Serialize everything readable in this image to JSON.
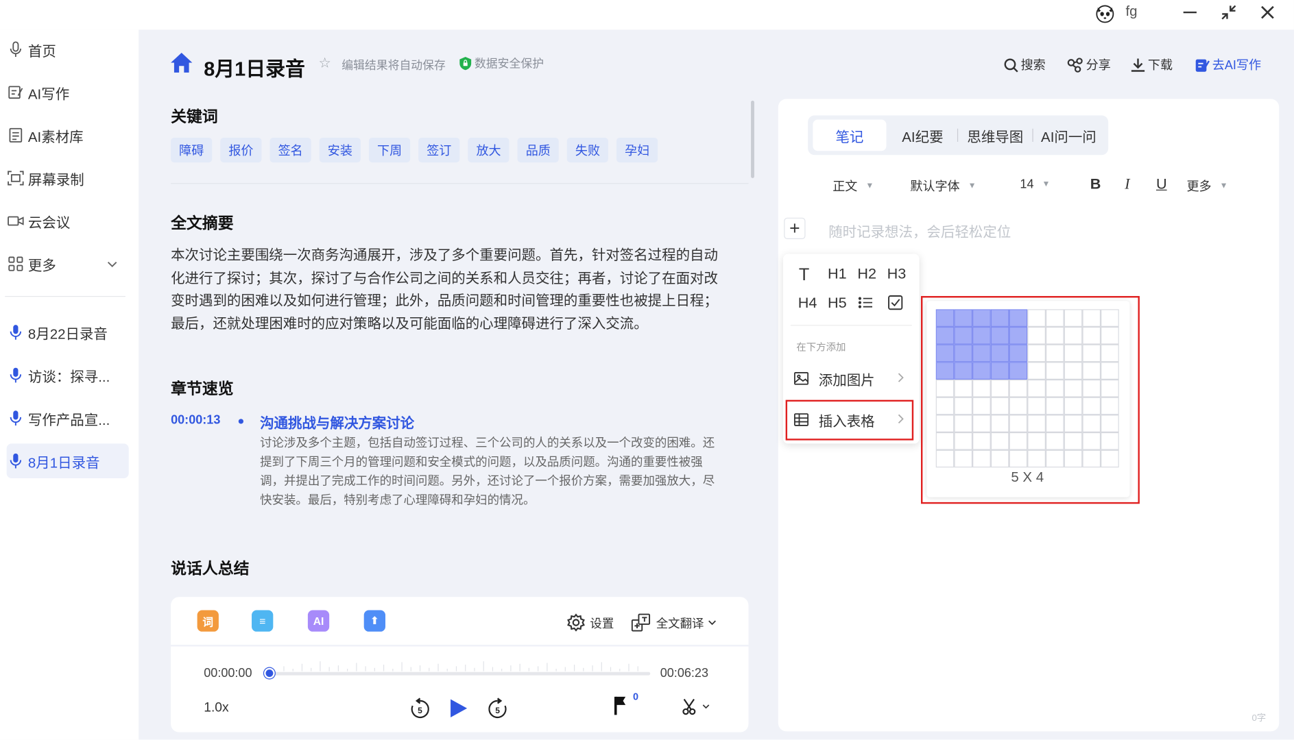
{
  "titlebar": {
    "user": "fg"
  },
  "sidebar": {
    "nav": [
      {
        "label": "首页",
        "icon": "mic-icon"
      },
      {
        "label": "AI写作",
        "icon": "ai-write-icon"
      },
      {
        "label": "AI素材库",
        "icon": "library-icon"
      },
      {
        "label": "屏幕录制",
        "icon": "screen-record-icon"
      },
      {
        "label": "云会议",
        "icon": "video-meeting-icon"
      },
      {
        "label": "更多",
        "icon": "grid-icon"
      }
    ],
    "recordings": [
      {
        "label": "8月22日录音"
      },
      {
        "label": "访谈：探寻..."
      },
      {
        "label": "写作产品宣..."
      },
      {
        "label": "8月1日录音",
        "active": true
      }
    ]
  },
  "header": {
    "title": "8月1日录音",
    "autosave": "编辑结果将自动保存",
    "secure": "数据安全保护",
    "actions": {
      "search": "搜索",
      "share": "分享",
      "download": "下载",
      "ai_write": "去AI写作"
    }
  },
  "content": {
    "keywords_title": "关键词",
    "keywords": [
      "障碍",
      "报价",
      "签名",
      "安装",
      "下周",
      "签订",
      "放大",
      "品质",
      "失败",
      "孕妇"
    ],
    "summary_title": "全文摘要",
    "summary_lines": [
      "本次讨论主要围绕一次商务沟通展开，涉及了多个重要问题。首先，针对签名过程的自动",
      "化进行了探讨；其次，探讨了与合作公司之间的关系和人员交往；再者，讨论了在面对改",
      "变时遇到的困难以及如何进行管理；此外，品质问题和时间管理的重要性也被提上日程；",
      "最后，还就处理困难时的应对策略以及可能面临的心理障碍进行了深入交流。"
    ],
    "chapters_title": "章节速览",
    "chapter": {
      "time": "00:00:13",
      "title": "沟通挑战与解决方案讨论",
      "desc_lines": [
        "讨论涉及多个主题，包括自动签订过程、三个公司的人的关系以及一个改变的困难。还",
        "提到了下周三个月的管理问题和安全模式的问题，以及品质问题。沟通的重要性被强",
        "调，并提出了完成工作的时间问题。另外，还讨论了一个报价方案，需要加强放大，尽",
        "快安装。最后，特别考虑了心理障碍和孕妇的情况。"
      ]
    },
    "speakers_title": "说话人总结"
  },
  "player": {
    "tools": [
      {
        "name": "keyword-tool-icon",
        "text": "词",
        "color": "#f39a3d"
      },
      {
        "name": "outline-tool-icon",
        "text": "≡",
        "color": "#4fb6f2"
      },
      {
        "name": "ai-tool-icon",
        "text": "AI",
        "color": "#a78bfa"
      },
      {
        "name": "upload-tool-icon",
        "text": "⬆",
        "color": "#4f8ef7"
      }
    ],
    "settings": "设置",
    "translate": "全文翻译",
    "current_time": "00:00:00",
    "total_time": "00:06:23",
    "progress": 0,
    "speed": "1.0x",
    "rewind": "5",
    "forward": "5",
    "flag_count": "0"
  },
  "notes": {
    "tabs": [
      "笔记",
      "AI纪要",
      "思维导图",
      "AI问一问"
    ],
    "active_tab": 0,
    "toolbar": {
      "style": "正文",
      "font": "默认字体",
      "size": "14",
      "bold": "B",
      "italic": "I",
      "underline": "U",
      "more": "更多"
    },
    "placeholder": "随时记录想法，会后轻松定位",
    "word_count": "0字"
  },
  "insert_menu": {
    "heading_buttons": [
      "T",
      "H1",
      "H2",
      "H3",
      "H4",
      "H5"
    ],
    "add_below": "在下方添加",
    "add_image": "添加图片",
    "insert_table": "插入表格"
  },
  "table_picker": {
    "columns": 10,
    "rows": 9,
    "selected_cols": 5,
    "selected_rows": 4,
    "size_label": "5 X 4",
    "highlight_color": "#a3adf7"
  }
}
